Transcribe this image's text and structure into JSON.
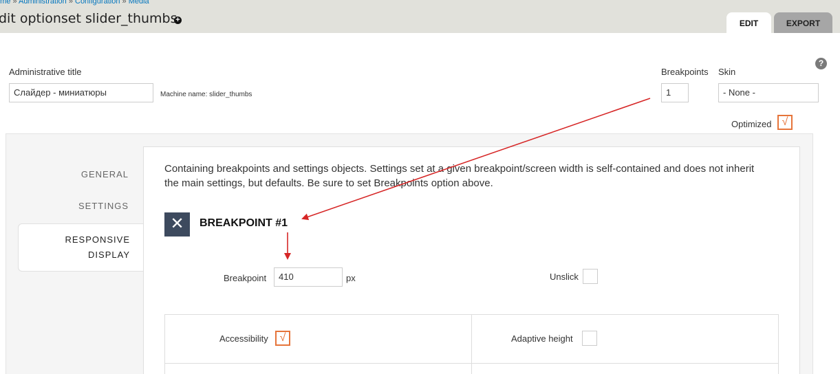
{
  "header": {
    "breadcrumb": [
      "ome",
      "Administration",
      "Configuration",
      "Media"
    ],
    "breadcrumb_separator": "»",
    "title": "dit optionset slider_thumbs",
    "shortcut_icon": "plus-circle-icon",
    "tabs": [
      {
        "label": "EDIT",
        "active": true
      },
      {
        "label": "EXPORT",
        "active": false
      }
    ]
  },
  "form": {
    "admin_title_label": "Administrative title",
    "admin_title_value": "Слайдер - миниатюры",
    "machine_name_text": "Machine name: slider_thumbs",
    "breakpoints_label": "Breakpoints",
    "breakpoints_value": "1",
    "skin_label": "Skin",
    "skin_value": "- None -",
    "optimized_label": "Optimized",
    "optimized_checked": true,
    "help_icon": "question-circle-icon"
  },
  "vertical_tabs": {
    "items": [
      {
        "label": "GENERAL",
        "active": false
      },
      {
        "label": "SETTINGS",
        "active": false
      },
      {
        "label_line1": "RESPONSIVE",
        "label_line2": "DISPLAY",
        "active": true
      }
    ]
  },
  "responsive": {
    "description": "Containing breakpoints and settings objects. Settings set at a given breakpoint/screen width is self-contained and does not inherit the main settings, but defaults. Be sure to set Breakpoints option above.",
    "remove_icon": "close-icon",
    "breakpoint_title": "BREAKPOINT #1",
    "breakpoint_label": "Breakpoint",
    "breakpoint_value": "410",
    "breakpoint_unit": "px",
    "unslick_label": "Unslick",
    "unslick_checked": false,
    "accessibility_label": "Accessibility",
    "accessibility_checked": true,
    "adaptive_height_label": "Adaptive height",
    "adaptive_height_checked": false
  },
  "colors": {
    "header_bg": "#e1e1db",
    "link": "#0074bd",
    "accent_check": "#e6743a",
    "annotation_arrow": "#d62626",
    "remove_button_bg": "#3d4a5e"
  }
}
